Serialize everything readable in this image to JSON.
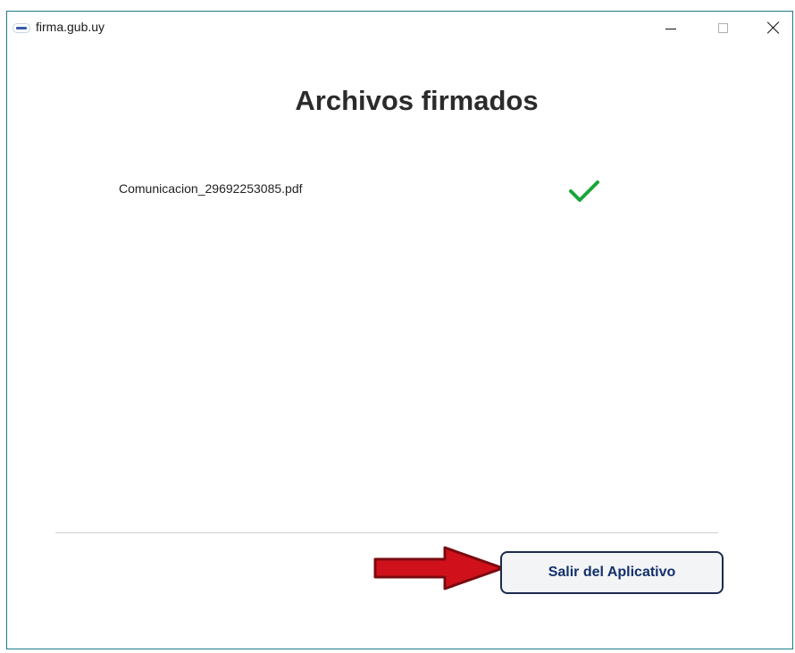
{
  "window": {
    "title": "firma.gub.uy",
    "controls": [
      "minimize-icon",
      "maximize-icon",
      "close-icon"
    ]
  },
  "main": {
    "heading": "Archivos firmados",
    "files": [
      {
        "name": "Comunicacion_29692253085.pdf",
        "status_icon": "check-icon",
        "status_color": "#1aa63a"
      }
    ]
  },
  "footer": {
    "exit_label": "Salir del Aplicativo"
  },
  "annotation": {
    "arrow_icon": "red-arrow-icon",
    "arrow_color": "#d0111b"
  }
}
